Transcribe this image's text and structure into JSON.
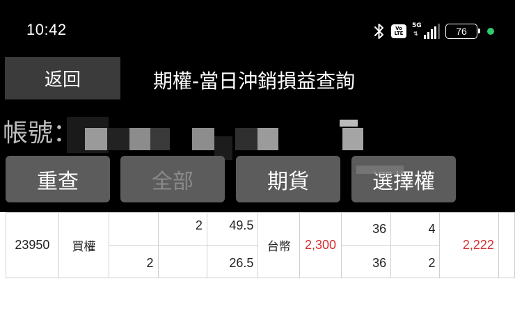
{
  "status_bar": {
    "time": "10:42",
    "battery_level": "76",
    "network": "5G",
    "volte_top": "Vo",
    "volte_bottom": "LTE",
    "signal_bars": 4,
    "charging_color": "#2ecc71",
    "icons": [
      "bluetooth-icon",
      "volte-icon",
      "signal-icon",
      "battery-icon"
    ]
  },
  "header": {
    "back_label": "返回",
    "title": "期權-當日沖銷損益查詢"
  },
  "account": {
    "label": "帳號："
  },
  "filters": [
    {
      "label": "重查",
      "enabled": true
    },
    {
      "label": "全部",
      "enabled": false
    },
    {
      "label": "期貨",
      "enabled": true
    },
    {
      "label": "選擇權",
      "enabled": true
    }
  ],
  "table": {
    "row": {
      "strike": "23950",
      "type": "買權",
      "currency": "台幣",
      "pnl": "2,300",
      "net": "2,222",
      "top": {
        "col3": "",
        "col4": "2",
        "price": "49.5",
        "col7": "36",
        "col8": "4"
      },
      "bottom": {
        "col3": "2",
        "col4": "",
        "price": "26.5",
        "col7": "36",
        "col8": "2"
      }
    },
    "highlight_color": "#d32f2f"
  }
}
